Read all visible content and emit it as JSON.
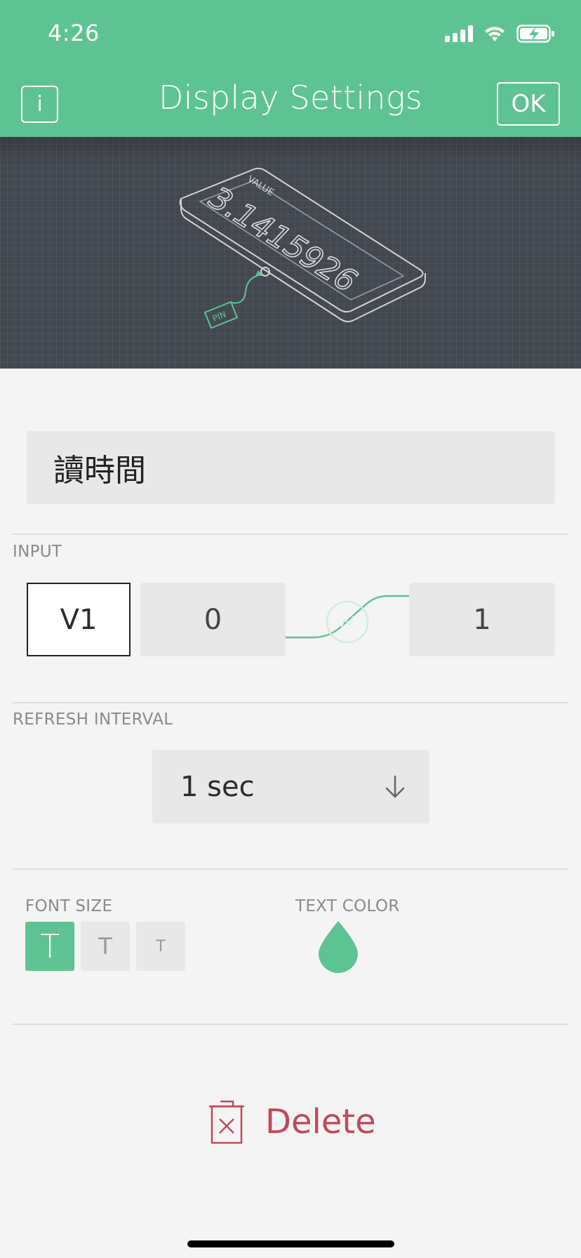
{
  "status_bar": {
    "time": "4:26"
  },
  "header": {
    "info_label": "i",
    "title": "Display Settings",
    "ok_label": "OK"
  },
  "preview": {
    "value_caption": "VALUE",
    "value_number": "3.1415926",
    "pin_caption": "PIN"
  },
  "widget_name": "讀時間",
  "input": {
    "section_label": "INPUT",
    "pin": "V1",
    "min": "0",
    "max": "1"
  },
  "refresh": {
    "section_label": "REFRESH INTERVAL",
    "value": "1 sec"
  },
  "font_size": {
    "section_label": "FONT SIZE",
    "options": [
      "T",
      "T",
      "T"
    ],
    "selected_index": 0
  },
  "text_color": {
    "section_label": "TEXT COLOR",
    "color": "#5ec392"
  },
  "delete_label": "Delete",
  "colors": {
    "accent": "#5ec392",
    "danger": "#c04a5c"
  }
}
